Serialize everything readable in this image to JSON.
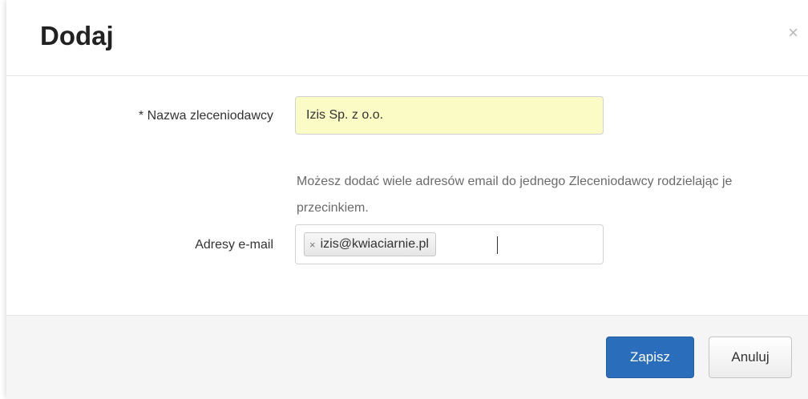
{
  "modal": {
    "title": "Dodaj",
    "close_label": "×"
  },
  "form": {
    "client_name_label": "* Nazwa zleceniodawcy",
    "client_name_value": "Izis Sp. z o.o.",
    "email_help": "Możesz dodać wiele adresów email do jednego Zleceniodawcy rodzielając je przecinkiem.",
    "email_label": "Adresy e-mail",
    "email_tags": [
      {
        "text": "izis@kwiaciarnie.pl",
        "remove_label": "×"
      }
    ]
  },
  "footer": {
    "save_label": "Zapisz",
    "cancel_label": "Anuluj"
  },
  "colors": {
    "primary": "#2a6ebb",
    "highlight_input": "#fbfbc5"
  }
}
